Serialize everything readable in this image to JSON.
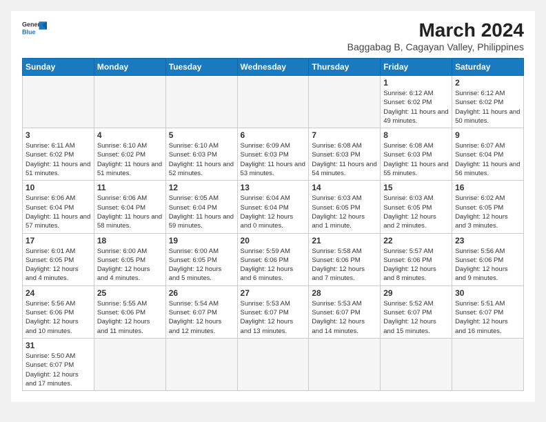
{
  "header": {
    "title": "March 2024",
    "location": "Baggabag B, Cagayan Valley, Philippines",
    "logo_general": "General",
    "logo_blue": "Blue"
  },
  "days_of_week": [
    "Sunday",
    "Monday",
    "Tuesday",
    "Wednesday",
    "Thursday",
    "Friday",
    "Saturday"
  ],
  "weeks": [
    [
      {
        "day": "",
        "info": ""
      },
      {
        "day": "",
        "info": ""
      },
      {
        "day": "",
        "info": ""
      },
      {
        "day": "",
        "info": ""
      },
      {
        "day": "",
        "info": ""
      },
      {
        "day": "1",
        "info": "Sunrise: 6:12 AM\nSunset: 6:02 PM\nDaylight: 11 hours and 49 minutes."
      },
      {
        "day": "2",
        "info": "Sunrise: 6:12 AM\nSunset: 6:02 PM\nDaylight: 11 hours and 50 minutes."
      }
    ],
    [
      {
        "day": "3",
        "info": "Sunrise: 6:11 AM\nSunset: 6:02 PM\nDaylight: 11 hours and 51 minutes."
      },
      {
        "day": "4",
        "info": "Sunrise: 6:10 AM\nSunset: 6:02 PM\nDaylight: 11 hours and 51 minutes."
      },
      {
        "day": "5",
        "info": "Sunrise: 6:10 AM\nSunset: 6:03 PM\nDaylight: 11 hours and 52 minutes."
      },
      {
        "day": "6",
        "info": "Sunrise: 6:09 AM\nSunset: 6:03 PM\nDaylight: 11 hours and 53 minutes."
      },
      {
        "day": "7",
        "info": "Sunrise: 6:08 AM\nSunset: 6:03 PM\nDaylight: 11 hours and 54 minutes."
      },
      {
        "day": "8",
        "info": "Sunrise: 6:08 AM\nSunset: 6:03 PM\nDaylight: 11 hours and 55 minutes."
      },
      {
        "day": "9",
        "info": "Sunrise: 6:07 AM\nSunset: 6:04 PM\nDaylight: 11 hours and 56 minutes."
      }
    ],
    [
      {
        "day": "10",
        "info": "Sunrise: 6:06 AM\nSunset: 6:04 PM\nDaylight: 11 hours and 57 minutes."
      },
      {
        "day": "11",
        "info": "Sunrise: 6:06 AM\nSunset: 6:04 PM\nDaylight: 11 hours and 58 minutes."
      },
      {
        "day": "12",
        "info": "Sunrise: 6:05 AM\nSunset: 6:04 PM\nDaylight: 11 hours and 59 minutes."
      },
      {
        "day": "13",
        "info": "Sunrise: 6:04 AM\nSunset: 6:04 PM\nDaylight: 12 hours and 0 minutes."
      },
      {
        "day": "14",
        "info": "Sunrise: 6:03 AM\nSunset: 6:05 PM\nDaylight: 12 hours and 1 minute."
      },
      {
        "day": "15",
        "info": "Sunrise: 6:03 AM\nSunset: 6:05 PM\nDaylight: 12 hours and 2 minutes."
      },
      {
        "day": "16",
        "info": "Sunrise: 6:02 AM\nSunset: 6:05 PM\nDaylight: 12 hours and 3 minutes."
      }
    ],
    [
      {
        "day": "17",
        "info": "Sunrise: 6:01 AM\nSunset: 6:05 PM\nDaylight: 12 hours and 4 minutes."
      },
      {
        "day": "18",
        "info": "Sunrise: 6:00 AM\nSunset: 6:05 PM\nDaylight: 12 hours and 4 minutes."
      },
      {
        "day": "19",
        "info": "Sunrise: 6:00 AM\nSunset: 6:05 PM\nDaylight: 12 hours and 5 minutes."
      },
      {
        "day": "20",
        "info": "Sunrise: 5:59 AM\nSunset: 6:06 PM\nDaylight: 12 hours and 6 minutes."
      },
      {
        "day": "21",
        "info": "Sunrise: 5:58 AM\nSunset: 6:06 PM\nDaylight: 12 hours and 7 minutes."
      },
      {
        "day": "22",
        "info": "Sunrise: 5:57 AM\nSunset: 6:06 PM\nDaylight: 12 hours and 8 minutes."
      },
      {
        "day": "23",
        "info": "Sunrise: 5:56 AM\nSunset: 6:06 PM\nDaylight: 12 hours and 9 minutes."
      }
    ],
    [
      {
        "day": "24",
        "info": "Sunrise: 5:56 AM\nSunset: 6:06 PM\nDaylight: 12 hours and 10 minutes."
      },
      {
        "day": "25",
        "info": "Sunrise: 5:55 AM\nSunset: 6:06 PM\nDaylight: 12 hours and 11 minutes."
      },
      {
        "day": "26",
        "info": "Sunrise: 5:54 AM\nSunset: 6:07 PM\nDaylight: 12 hours and 12 minutes."
      },
      {
        "day": "27",
        "info": "Sunrise: 5:53 AM\nSunset: 6:07 PM\nDaylight: 12 hours and 13 minutes."
      },
      {
        "day": "28",
        "info": "Sunrise: 5:53 AM\nSunset: 6:07 PM\nDaylight: 12 hours and 14 minutes."
      },
      {
        "day": "29",
        "info": "Sunrise: 5:52 AM\nSunset: 6:07 PM\nDaylight: 12 hours and 15 minutes."
      },
      {
        "day": "30",
        "info": "Sunrise: 5:51 AM\nSunset: 6:07 PM\nDaylight: 12 hours and 16 minutes."
      }
    ],
    [
      {
        "day": "31",
        "info": "Sunrise: 5:50 AM\nSunset: 6:07 PM\nDaylight: 12 hours and 17 minutes."
      },
      {
        "day": "",
        "info": ""
      },
      {
        "day": "",
        "info": ""
      },
      {
        "day": "",
        "info": ""
      },
      {
        "day": "",
        "info": ""
      },
      {
        "day": "",
        "info": ""
      },
      {
        "day": "",
        "info": ""
      }
    ]
  ]
}
